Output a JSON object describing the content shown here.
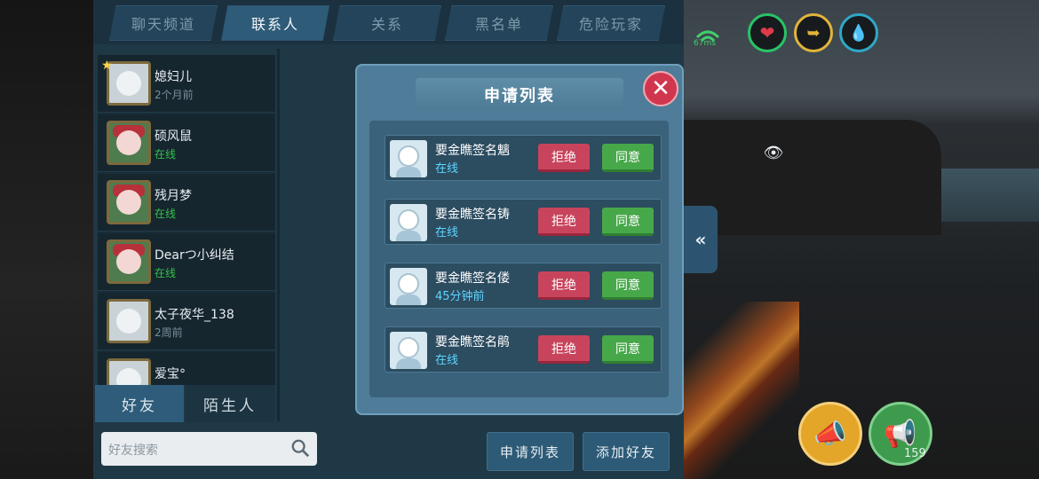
{
  "tabs": [
    "聊天频道",
    "联系人",
    "关系",
    "黑名单",
    "危险玩家"
  ],
  "active_tab": 1,
  "contacts": [
    {
      "name": "媳妇儿",
      "status": "2个月前",
      "online": false
    },
    {
      "name": "硕风鼠",
      "status": "在线",
      "online": true
    },
    {
      "name": "残月梦",
      "status": "在线",
      "online": true
    },
    {
      "name": "Dearつ小纠结",
      "status": "在线",
      "online": true
    },
    {
      "name": "太子夜华_138",
      "status": "2周前",
      "online": false
    },
    {
      "name": "爱宝°",
      "status": "",
      "online": false
    }
  ],
  "bottom_tabs": {
    "friends": "好友",
    "strangers": "陌生人"
  },
  "search": {
    "placeholder": "好友搜索"
  },
  "footer": {
    "request_list": "申请列表",
    "add_friend": "添加好友"
  },
  "modal": {
    "title": "申请列表",
    "reject_label": "拒绝",
    "accept_label": "同意",
    "requests": [
      {
        "name": "要金瞧签名魑",
        "status": "在线"
      },
      {
        "name": "要金瞧签名铸",
        "status": "在线"
      },
      {
        "name": "要金瞧签名偻",
        "status": "45分钟前"
      },
      {
        "name": "要金瞧签名鹃",
        "status": "在线"
      }
    ]
  },
  "hud": {
    "ping": "67ms",
    "megaphone_count": "159"
  },
  "colors": {
    "online": "#35c24a",
    "reject": "#c8445c",
    "accept": "#47a84a"
  }
}
